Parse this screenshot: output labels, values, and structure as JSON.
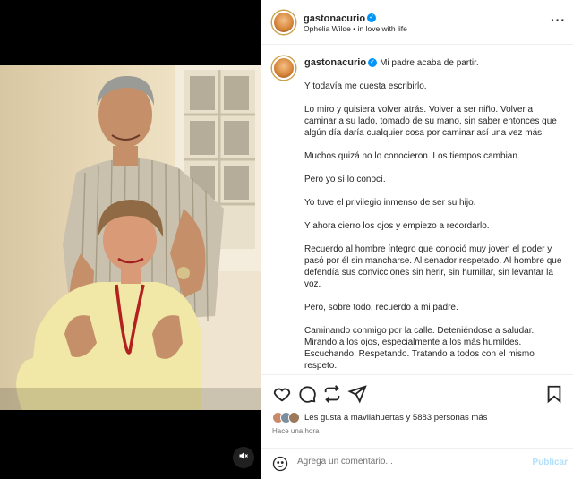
{
  "post": {
    "username": "gastonacurio",
    "subtitle": "Ophelia Wilde • in love with life",
    "caption_first": "Mi padre acaba de partir.",
    "paragraphs": [
      "Y todavía me cuesta escribirlo.",
      "Lo miro y quisiera volver atrás. Volver a ser niño. Volver a caminar a su lado, tomado de su mano, sin saber entonces que algún día daría cualquier cosa por caminar así una vez más.",
      "Muchos quizá no lo conocieron. Los tiempos cambian.",
      "Pero yo sí lo conocí.",
      "Yo tuve el privilegio inmenso de ser su hijo.",
      "Y ahora cierro los ojos y empiezo a recordarlo.",
      "Recuerdo al hombre íntegro que conoció muy joven el poder y pasó por él sin mancharse. Al senador respetado. Al hombre que defendía sus convicciones sin herir, sin humillar, sin levantar la voz.",
      "Pero, sobre todo, recuerdo a mi padre.",
      "Caminando conmigo por la calle. Deteniéndose a saludar.\nMirando a los ojos, especialmente a los más humildes.\nEscuchando. Respetando. Tratando a todos con el mismo respeto."
    ],
    "likes_text": "Les gusta a mavilahuertas y 5883 personas más",
    "time": "Hace una hora",
    "comment_placeholder": "Agrega un comentario...",
    "publish_label": "Publicar"
  },
  "icons": {
    "more": "more-options-icon",
    "like": "heart-icon",
    "comment": "comment-icon",
    "share": "share-icon",
    "send": "send-icon",
    "save": "bookmark-icon",
    "emoji": "emoji-icon",
    "mute": "muted-speaker-icon"
  },
  "colors": {
    "verified": "#0095f6",
    "publish": "#b2dffc",
    "secondary_text": "#737373"
  }
}
